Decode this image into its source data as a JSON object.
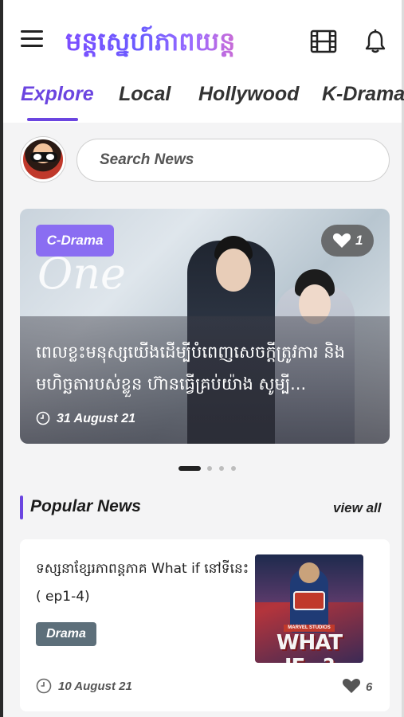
{
  "app": {
    "logo_text": "មន្តស្នេហ៍ភាពយន្ត"
  },
  "header": {
    "menu_icon": "hamburger-menu-icon",
    "film_icon": "film-strip-icon",
    "bell_icon": "notification-bell-icon"
  },
  "tabs": [
    {
      "label": "Explore",
      "active": true
    },
    {
      "label": "Local",
      "active": false
    },
    {
      "label": "Hollywood",
      "active": false
    },
    {
      "label": "K-Drama",
      "active": false
    }
  ],
  "search": {
    "placeholder": "Search News"
  },
  "featured": {
    "tag": "C-Drama",
    "likes": "1",
    "background_text": "One",
    "title": "ពេលខ្លះមនុស្សយើងដើម្បីបំពេញសេចក្តីត្រូវការ និងមហិច្ឆតារបស់ខ្លួន ហ៊ានធ្វើគ្រប់យ៉ាង សូម្បី...",
    "date": "31 August 21"
  },
  "carousel": {
    "total": 4,
    "active_index": 0
  },
  "popular": {
    "title": "Popular News",
    "view_all": "view all",
    "items": [
      {
        "title": "ទស្សនាខ្សែរភាពន្តភាគ What if នៅទីនេះ ( ep1-4)",
        "tag": "Drama",
        "thumb_studio": "MARVEL STUDIOS",
        "thumb_title": "WHAT IF...?",
        "date": "10 August 21",
        "likes": "6"
      }
    ]
  },
  "colors": {
    "accent": "#6b45e0",
    "tag_purple": "#8a6df2",
    "tag_slate": "#5d6f7a"
  }
}
